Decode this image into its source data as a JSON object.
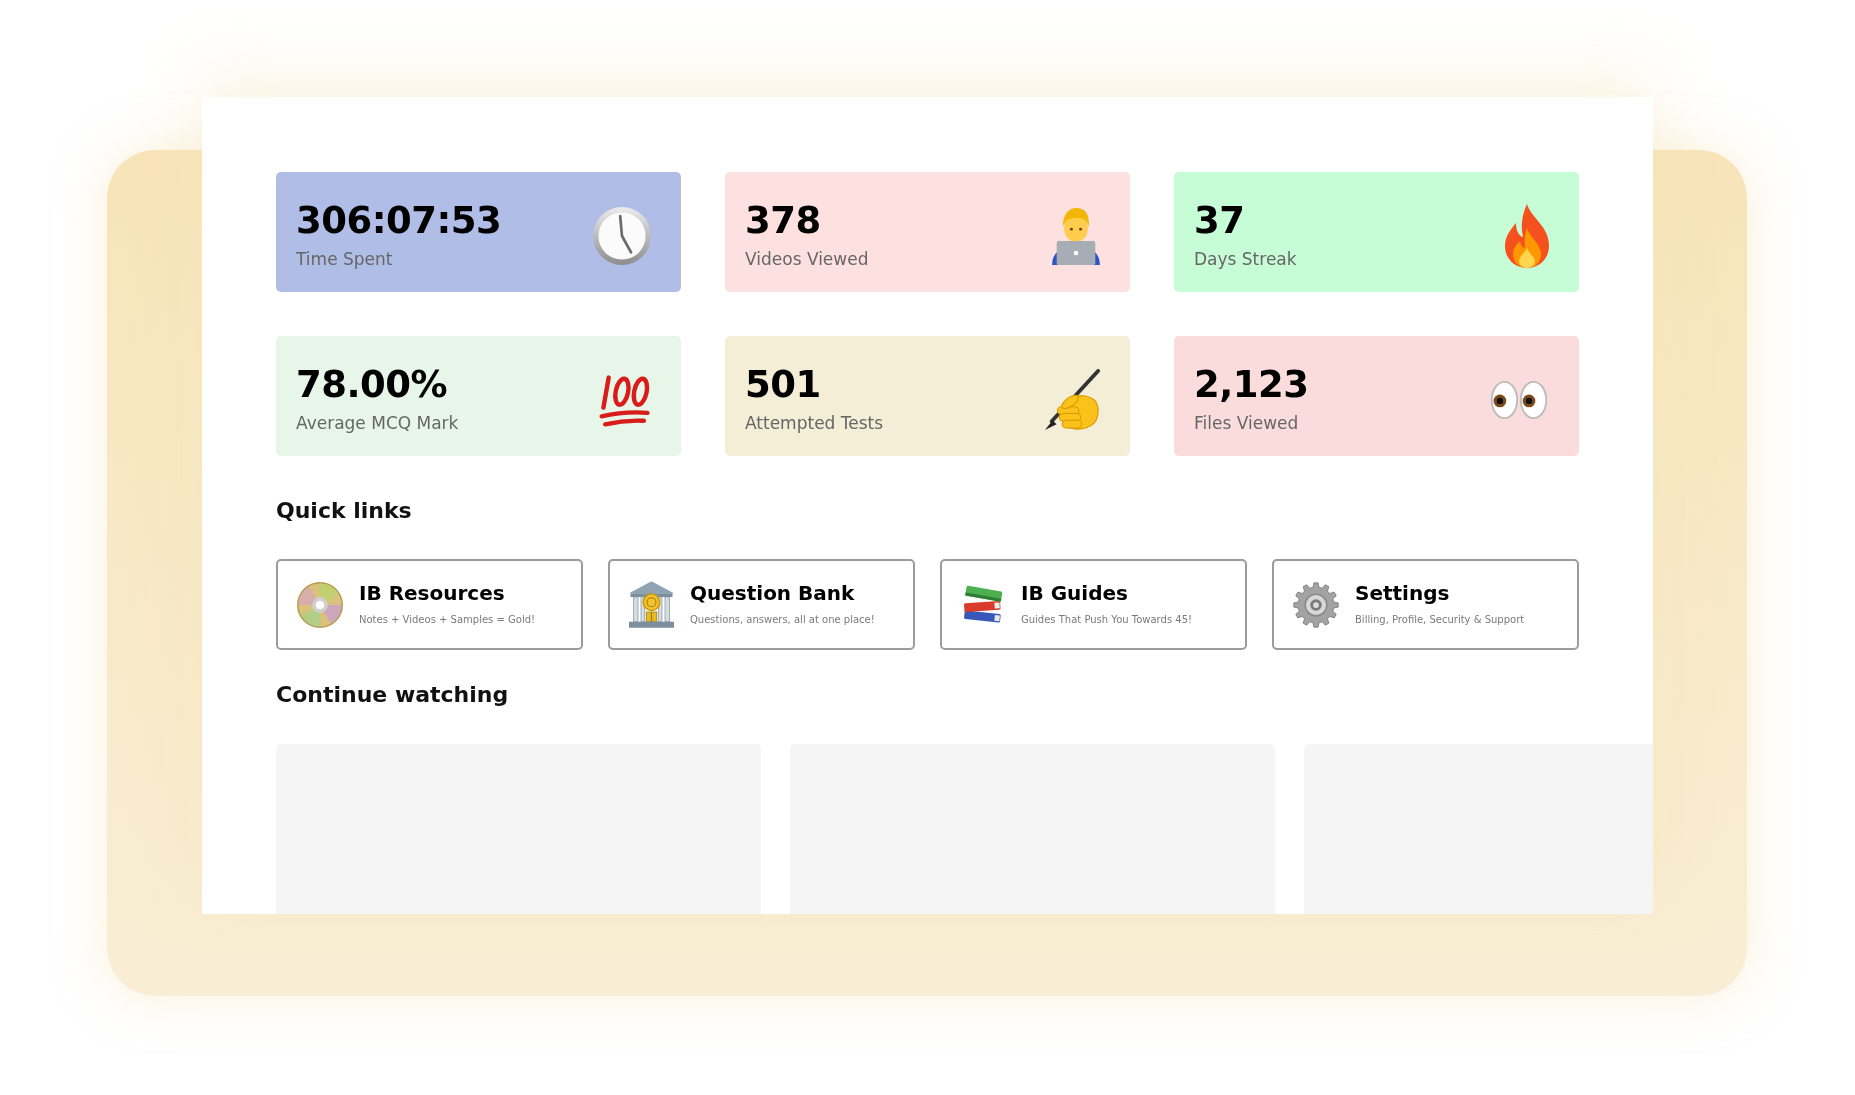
{
  "stats": [
    {
      "value": "306:07:53",
      "label": "Time Spent",
      "color": "#b0bde6"
    },
    {
      "value": "378",
      "label": "Videos Viewed",
      "color": "#fde1e1"
    },
    {
      "value": "37",
      "label": "Days Streak",
      "color": "#c6fdd6"
    },
    {
      "value": "78.00%",
      "label": "Average MCQ Mark",
      "color": "#e7f6e8"
    },
    {
      "value": "501",
      "label": "Attempted Tests",
      "color": "#f4eed7"
    },
    {
      "value": "2,123",
      "label": "Files Viewed",
      "color": "#fbdcdd"
    }
  ],
  "quick_links": {
    "title": "Quick links",
    "items": [
      {
        "title": "IB Resources",
        "subtitle": "Notes + Videos + Samples = Gold!"
      },
      {
        "title": "Question Bank",
        "subtitle": "Questions, answers, all at one place!"
      },
      {
        "title": "IB Guides",
        "subtitle": "Guides That Push You Towards 45!"
      },
      {
        "title": "Settings",
        "subtitle": "Billing, Profile, Security & Support"
      }
    ]
  },
  "continue_watching": {
    "title": "Continue watching",
    "items": [
      {
        "kind": "skeleton"
      },
      {
        "kind": "skeleton"
      },
      {
        "kind": "skeleton"
      }
    ]
  }
}
